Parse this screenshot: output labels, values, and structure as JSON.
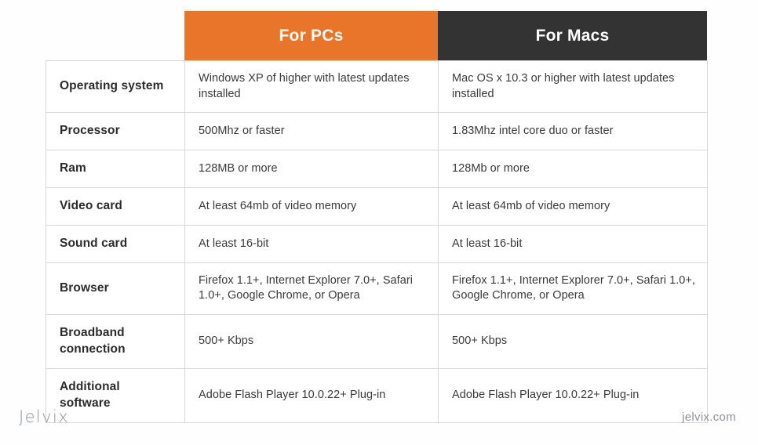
{
  "table": {
    "headers": [
      {
        "label": "",
        "color": ""
      },
      {
        "label": "For PCs",
        "color": "#e8752a"
      },
      {
        "label": "For Macs",
        "color": "#333333"
      }
    ],
    "rows": [
      {
        "label": "Operating system",
        "pc": "Windows XP of higher with latest updates installed",
        "mac": "Mac OS x 10.3 or higher with latest updates installed"
      },
      {
        "label": "Processor",
        "pc": "500Mhz or faster",
        "mac": "1.83Mhz intel core duo or faster"
      },
      {
        "label": "Ram",
        "pc": "128MB or more",
        "mac": "128Mb or more"
      },
      {
        "label": "Video card",
        "pc": "At least 64mb of video memory",
        "mac": "At least 64mb of video memory"
      },
      {
        "label": "Sound card",
        "pc": "At least 16-bit",
        "mac": "At least 16-bit"
      },
      {
        "label": "Browser",
        "pc": "Firefox 1.1+, Internet Explorer 7.0+, Safari 1.0+, Google Chrome, or Opera",
        "mac": "Firefox 1.1+, Internet Explorer 7.0+, Safari 1.0+, Google Chrome, or Opera"
      },
      {
        "label": "Broadband connection",
        "pc": "500+ Kbps",
        "mac": "500+ Kbps"
      },
      {
        "label": "Additional software",
        "pc": "Adobe Flash Player 10.0.22+ Plug-in",
        "mac": "Adobe Flash Player 10.0.22+ Plug-in"
      }
    ]
  },
  "footer": {
    "logo": "Jelvix",
    "site": "jelvix.com"
  }
}
